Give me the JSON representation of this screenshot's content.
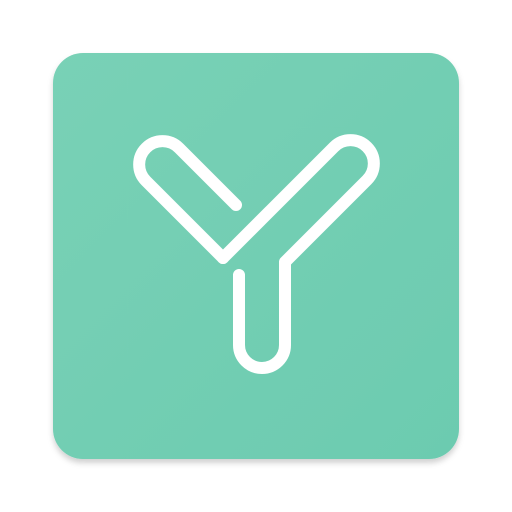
{
  "app_icon": {
    "icon_name": "y-monogram-icon",
    "colors": {
      "tile_light": "#79d1b6",
      "tile_dark": "#6ccbb0",
      "tile_shadow": "#5fae98",
      "glyph": "#ffffff"
    }
  }
}
